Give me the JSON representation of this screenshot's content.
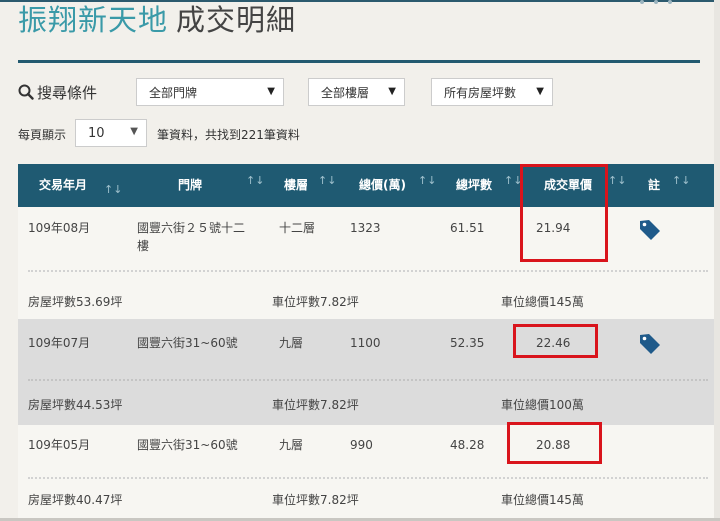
{
  "header": {
    "title_main": "振翔新天地",
    "title_sub": "成交明細"
  },
  "search": {
    "label": "搜尋條件",
    "filters": [
      {
        "value": "全部門牌"
      },
      {
        "value": "全部樓層"
      },
      {
        "value": "所有房屋坪數"
      }
    ]
  },
  "pagination": {
    "per_page_label": "每頁顯示",
    "per_page_value": "10",
    "summary": "筆資料，共找到221筆資料"
  },
  "table": {
    "columns": [
      "交易年月",
      "門牌",
      "樓層",
      "總價(萬)",
      "總坪數",
      "成交單價",
      "註"
    ],
    "rows": [
      {
        "date": "109年08月",
        "address": "國豐六街２５號十二樓",
        "floor": "十二層",
        "total_price": "1323",
        "total_area": "61.51",
        "unit_price": "21.94",
        "has_tag": true,
        "house_area": "房屋坪數53.69坪",
        "parking_area": "車位坪數7.82坪",
        "parking_price": "車位總價145萬"
      },
      {
        "date": "109年07月",
        "address": "國豐六街31~60號",
        "floor": "九層",
        "total_price": "1100",
        "total_area": "52.35",
        "unit_price": "22.46",
        "has_tag": true,
        "house_area": "房屋坪數44.53坪",
        "parking_area": "車位坪數7.82坪",
        "parking_price": "車位總價100萬"
      },
      {
        "date": "109年05月",
        "address": "國豐六街31~60號",
        "floor": "九層",
        "total_price": "990",
        "total_area": "48.28",
        "unit_price": "20.88",
        "has_tag": false,
        "house_area": "房屋坪數40.47坪",
        "parking_area": "車位坪數7.82坪",
        "parking_price": "車位總價145萬"
      }
    ]
  },
  "colors": {
    "header_bg": "#1f5a72",
    "accent": "#3a9aa8",
    "highlight": "#d9141c",
    "tag": "#1f5a8a"
  }
}
